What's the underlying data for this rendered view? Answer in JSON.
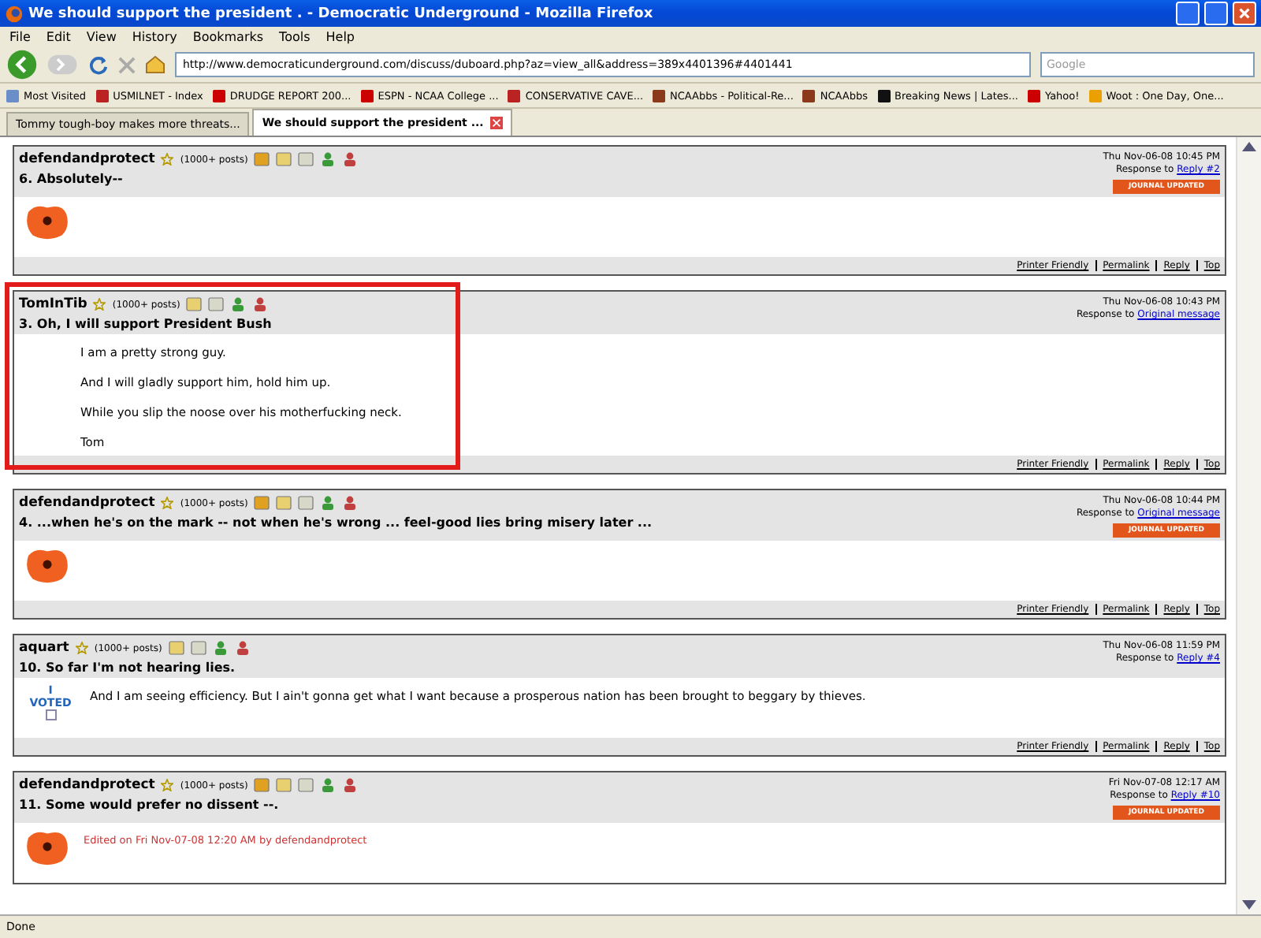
{
  "window": {
    "title": "We should support the president . - Democratic Underground - Mozilla Firefox"
  },
  "menu": [
    "File",
    "Edit",
    "View",
    "History",
    "Bookmarks",
    "Tools",
    "Help"
  ],
  "address": {
    "value": "http://www.democraticunderground.com/discuss/duboard.php?az=view_all&address=389x4401396#4401441"
  },
  "search": {
    "placeholder": "Google"
  },
  "bookmarks": [
    {
      "label": "Most Visited",
      "kind": "page"
    },
    {
      "label": "USMILNET - Index",
      "kind": "flag"
    },
    {
      "label": "DRUDGE REPORT 200...",
      "kind": "y"
    },
    {
      "label": "ESPN - NCAA College ...",
      "kind": "espn"
    },
    {
      "label": "CONSERVATIVE CAVE...",
      "kind": "flag"
    },
    {
      "label": "NCAAbbs - Political-Re...",
      "kind": "ncaa"
    },
    {
      "label": "NCAAbbs",
      "kind": "ncaa"
    },
    {
      "label": "Breaking News | Lates...",
      "kind": "slash"
    },
    {
      "label": "Yahoo!",
      "kind": "y"
    },
    {
      "label": "Woot : One Day, One...",
      "kind": "woot"
    }
  ],
  "tabs": [
    {
      "label": "Tommy tough-boy makes more threats...",
      "selected": false
    },
    {
      "label": "We should support the president ...",
      "selected": true
    }
  ],
  "posts": [
    {
      "author": "defendandprotect",
      "posts": "(1000+ posts)",
      "journal": true,
      "date": "Thu Nov-06-08 10:45 PM",
      "response_label": "Response to",
      "response_link": "Reply #2",
      "badge": "JOURNAL UPDATED",
      "title": "6. Absolutely--",
      "avatar": {
        "kind": "poppy"
      },
      "highlighted": false,
      "footer": [
        "Printer Friendly",
        "Permalink",
        "Reply",
        "Top"
      ]
    },
    {
      "author": "TomInTib",
      "posts": "(1000+ posts)",
      "journal": false,
      "date": "Thu Nov-06-08 10:43 PM",
      "response_label": "Response to",
      "response_link": "Original message",
      "title": "3. Oh, I will support President Bush",
      "lines": [
        "I am a pretty strong guy.",
        "And I will gladly support him, hold him up.",
        "While you slip the noose over his motherfucking neck.",
        "Tom"
      ],
      "highlighted": true,
      "footer": [
        "Printer Friendly",
        "Permalink",
        "Reply",
        "Top"
      ]
    },
    {
      "author": "defendandprotect",
      "posts": "(1000+ posts)",
      "journal": true,
      "date": "Thu Nov-06-08 10:44 PM",
      "response_label": "Response to",
      "response_link": "Original message",
      "badge": "JOURNAL UPDATED",
      "title": "4. ...when he's on the mark -- not when he's wrong ... feel-good lies bring misery later ...",
      "avatar": {
        "kind": "poppy"
      },
      "highlighted": false,
      "footer": [
        "Printer Friendly",
        "Permalink",
        "Reply",
        "Top"
      ]
    },
    {
      "author": "aquart",
      "posts": "(1000+ posts)",
      "journal": false,
      "date": "Thu Nov-06-08 11:59 PM",
      "response_label": "Response to",
      "response_link": "Reply #4",
      "title": "10. So far I'm not hearing lies.",
      "avatar": {
        "kind": "voted",
        "top": "I",
        "bottom": "VOTED"
      },
      "lines": [
        "And I am seeing efficiency. But I ain't gonna get what I want because a prosperous nation has been brought to beggary by thieves."
      ],
      "highlighted": false,
      "footer": [
        "Printer Friendly",
        "Permalink",
        "Reply",
        "Top"
      ]
    },
    {
      "author": "defendandprotect",
      "posts": "(1000+ posts)",
      "journal": true,
      "date": "Fri Nov-07-08 12:17 AM",
      "response_label": "Response to",
      "response_link": "Reply #10",
      "badge": "JOURNAL UPDATED",
      "title": "11. Some would prefer no dissent --.",
      "avatar": {
        "kind": "poppy"
      },
      "edited": "Edited on Fri Nov-07-08 12:20 AM by defendandprotect",
      "highlighted": false
    }
  ],
  "status": "Done"
}
